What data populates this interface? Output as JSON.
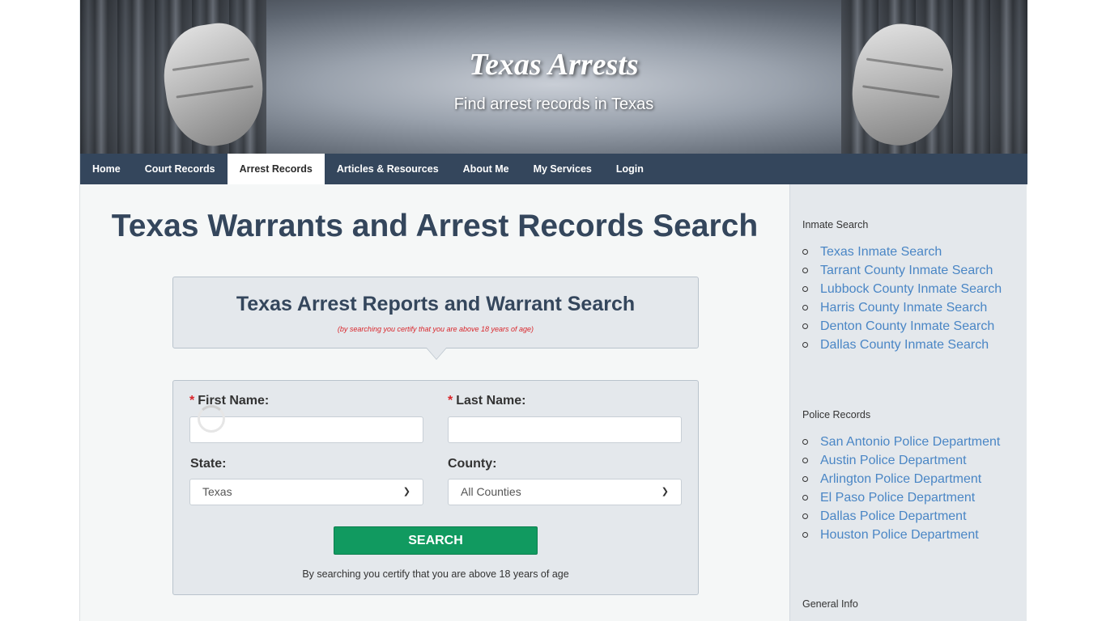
{
  "banner": {
    "site_title": "Texas Arrests",
    "tagline": "Find arrest records in Texas"
  },
  "nav": {
    "items": [
      {
        "label": "Home"
      },
      {
        "label": "Court Records"
      },
      {
        "label": "Arrest Records",
        "active": true
      },
      {
        "label": "Articles & Resources"
      },
      {
        "label": "About Me"
      },
      {
        "label": "My Services"
      },
      {
        "label": "Login"
      }
    ]
  },
  "main": {
    "page_title": "Texas Warrants and Arrest Records Search",
    "search_box": {
      "heading": "Texas Arrest Reports and Warrant Search",
      "note": "(by searching you certify that you are above 18 years of age)"
    },
    "form": {
      "required_mark": "*",
      "first_name_label": "First Name:",
      "first_name_value": "",
      "last_name_label": "Last Name:",
      "last_name_value": "",
      "state_label": "State:",
      "state_value": "Texas",
      "county_label": "County:",
      "county_value": "All Counties",
      "search_button": "SEARCH",
      "certify_text": "By searching you certify that you are above 18 years of age"
    }
  },
  "sidebar": {
    "inmate_search": {
      "heading": "Inmate Search",
      "links": [
        "Texas Inmate Search",
        "Tarrant County Inmate Search",
        "Lubbock County Inmate Search",
        "Harris County Inmate Search",
        "Denton County Inmate Search",
        "Dallas County Inmate Search"
      ]
    },
    "police_records": {
      "heading": "Police Records",
      "links": [
        "San Antonio Police Department",
        "Austin Police Department",
        "Arlington Police Department",
        "El Paso Police Department",
        "Dallas Police Department",
        "Houston Police Department"
      ]
    },
    "general_info": {
      "heading": "General Info"
    }
  },
  "colors": {
    "nav_bg": "#34465c",
    "title_color": "#34465c",
    "link_color": "#4a86c5",
    "button_green": "#119a60",
    "required_red": "#d9262b"
  }
}
